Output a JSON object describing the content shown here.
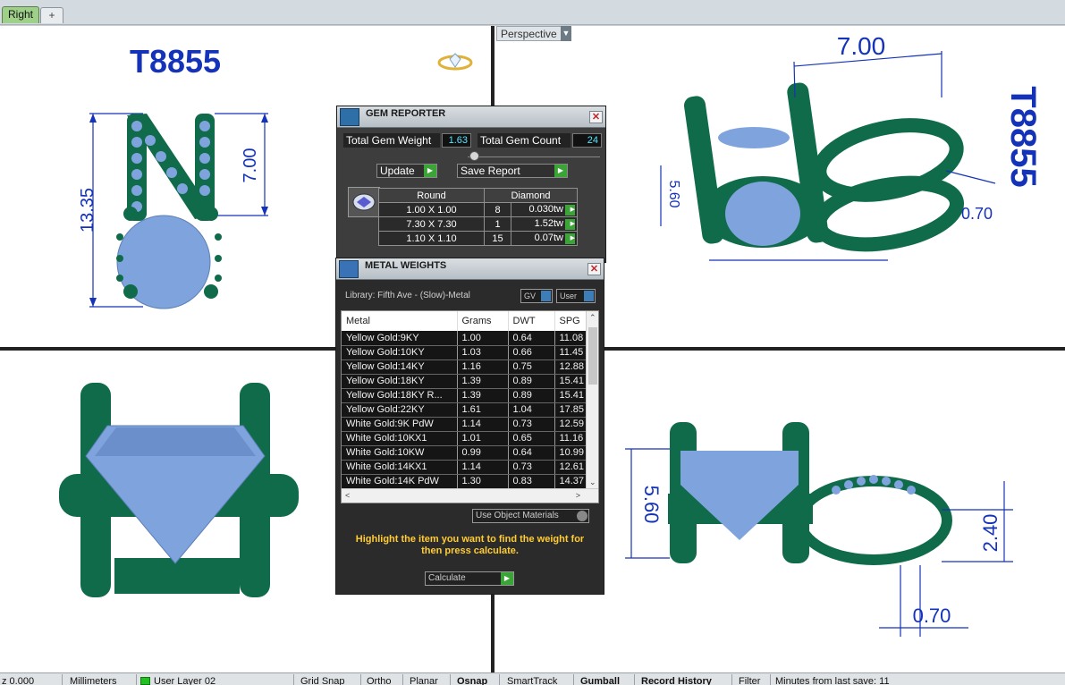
{
  "tabs": {
    "active": "Right",
    "add_icon": "+"
  },
  "viewports": {
    "top_left": {
      "title": "T8855"
    },
    "top_right": {
      "label": "Perspective"
    }
  },
  "dimensions": {
    "tl_height": "13.35",
    "tl_width": "7.00",
    "tr_top": "7.00",
    "tr_left": "5.60",
    "tr_right": "0.70",
    "br_height": "5.60",
    "br_right": "2.40",
    "br_bottom": "0.70",
    "tr_text": "T8855"
  },
  "gem_reporter": {
    "title": "GEM REPORTER",
    "total_weight_label": "Total Gem Weight",
    "total_weight_value": "1.63",
    "total_count_label": "Total Gem Count",
    "total_count_value": "24",
    "update_label": "Update",
    "save_label": "Save Report",
    "table_headers": [
      "Round",
      "Diamond"
    ],
    "rows": [
      {
        "size": "1.00 X 1.00",
        "count": "8",
        "weight": "0.030tw"
      },
      {
        "size": "7.30 X 7.30",
        "count": "1",
        "weight": "1.52tw"
      },
      {
        "size": "1.10 X 1.10",
        "count": "15",
        "weight": "0.07tw"
      }
    ]
  },
  "metal_weights": {
    "title": "METAL WEIGHTS",
    "library": "Library: Fifth Ave - (Slow)-Metal",
    "toggle_gv": "GV",
    "toggle_user": "User",
    "columns": [
      "Metal",
      "Grams",
      "DWT",
      "SPG"
    ],
    "rows": [
      {
        "metal": "Yellow Gold:9KY",
        "grams": "1.00",
        "dwt": "0.64",
        "spg": "11.08"
      },
      {
        "metal": "Yellow Gold:10KY",
        "grams": "1.03",
        "dwt": "0.66",
        "spg": "11.45"
      },
      {
        "metal": "Yellow Gold:14KY",
        "grams": "1.16",
        "dwt": "0.75",
        "spg": "12.88"
      },
      {
        "metal": "Yellow Gold:18KY",
        "grams": "1.39",
        "dwt": "0.89",
        "spg": "15.41"
      },
      {
        "metal": "Yellow Gold:18KY R...",
        "grams": "1.39",
        "dwt": "0.89",
        "spg": "15.41"
      },
      {
        "metal": "Yellow Gold:22KY",
        "grams": "1.61",
        "dwt": "1.04",
        "spg": "17.85"
      },
      {
        "metal": "White Gold:9K PdW",
        "grams": "1.14",
        "dwt": "0.73",
        "spg": "12.59"
      },
      {
        "metal": "White Gold:10KX1",
        "grams": "1.01",
        "dwt": "0.65",
        "spg": "11.16"
      },
      {
        "metal": "White Gold:10KW",
        "grams": "0.99",
        "dwt": "0.64",
        "spg": "10.99"
      },
      {
        "metal": "White Gold:14KX1",
        "grams": "1.14",
        "dwt": "0.73",
        "spg": "12.61"
      },
      {
        "metal": "White Gold:14K PdW",
        "grams": "1.30",
        "dwt": "0.83",
        "spg": "14.37"
      }
    ],
    "use_object_materials": "Use Object Materials",
    "hint": "Highlight the item you want to find the weight for then press calculate.",
    "calculate_label": "Calculate"
  },
  "status_bar": {
    "z": "z 0.000",
    "units": "Millimeters",
    "layer": "User Layer 02",
    "grid_snap": "Grid Snap",
    "ortho": "Ortho",
    "planar": "Planar",
    "osnap": "Osnap",
    "smarttrack": "SmartTrack",
    "gumball": "Gumball",
    "record_history": "Record History",
    "filter": "Filter",
    "save_info": "Minutes from last save: 11"
  },
  "colors": {
    "metal": "#0f6b4a",
    "gem": "#7fa4dd",
    "dimension": "#1533b8",
    "viewport_bg": "#ffffff",
    "panel_bg": "#3d3d3d",
    "accent_green": "#3ba436"
  }
}
